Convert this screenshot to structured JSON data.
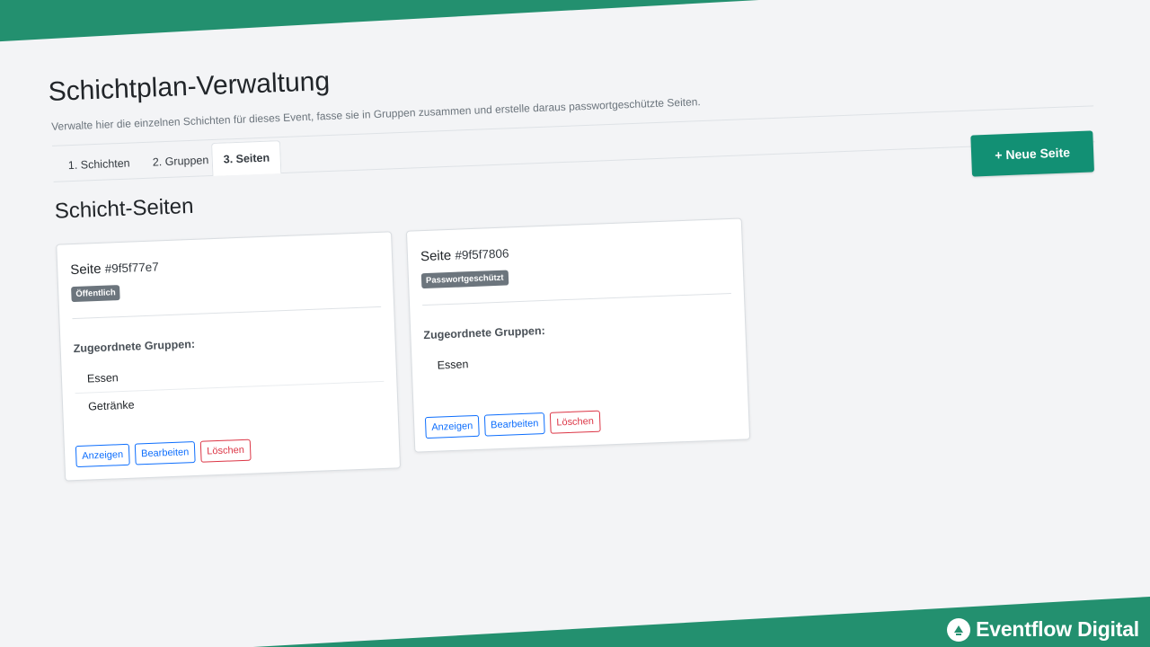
{
  "header": {
    "title": "Schichtplan-Verwaltung",
    "subtitle": "Verwalte hier die einzelnen Schichten für dieses Event, fasse sie in Gruppen zusammen und erstelle daraus passwortgeschützte Seiten."
  },
  "tabs": [
    {
      "label": "1. Schichten",
      "active": false
    },
    {
      "label": "2. Gruppen",
      "active": false
    },
    {
      "label": "3. Seiten",
      "active": true
    }
  ],
  "actions": {
    "new_page": "+ Neue Seite"
  },
  "section": {
    "title": "Schicht-Seiten"
  },
  "cards": [
    {
      "title_prefix": "Seite",
      "hash": "#9f5f77e7",
      "badge": "Öffentlich",
      "groups_label": "Zugeordnete Gruppen:",
      "groups": [
        "Essen",
        "Getränke"
      ],
      "buttons": {
        "view": "Anzeigen",
        "edit": "Bearbeiten",
        "delete": "Löschen"
      }
    },
    {
      "title_prefix": "Seite",
      "hash": "#9f5f7806",
      "badge": "Passwortgeschützt",
      "groups_label": "Zugeordnete Gruppen:",
      "groups": [
        "Essen"
      ],
      "buttons": {
        "view": "Anzeigen",
        "edit": "Bearbeiten",
        "delete": "Löschen"
      }
    }
  ],
  "brand": {
    "name": "Eventflow Digital"
  },
  "colors": {
    "brand_green": "#23906f",
    "primary_button": "#129074",
    "badge_gray": "#6c757d",
    "outline_blue": "#0d6efd",
    "outline_red": "#dc3545"
  }
}
